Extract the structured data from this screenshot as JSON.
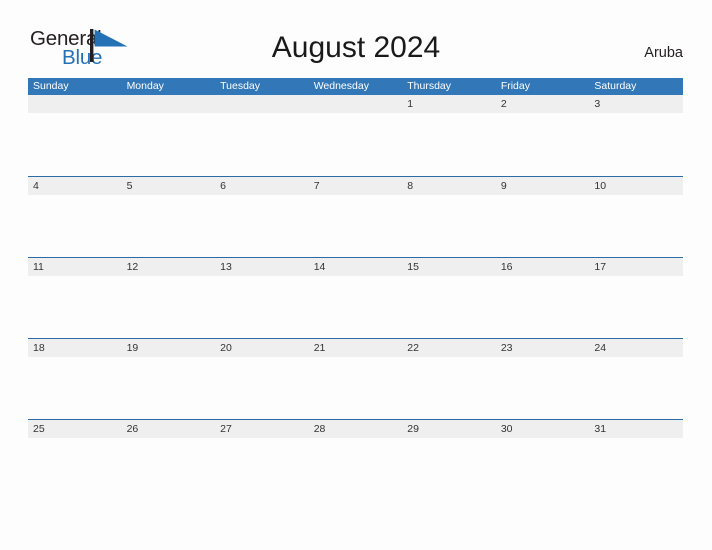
{
  "brand": {
    "word_one": "General",
    "word_two": "Blue",
    "flag_icon": "blue-flag-icon",
    "color_dark": "#231f20",
    "color_blue": "#2571b6"
  },
  "header": {
    "title": "August 2024",
    "country": "Aruba"
  },
  "calendar": {
    "month": "August",
    "year": "2024",
    "header_bg": "#3277b8",
    "row_border_color": "#2b6ca8",
    "date_band_bg": "#efefef",
    "weekdays": [
      "Sunday",
      "Monday",
      "Tuesday",
      "Wednesday",
      "Thursday",
      "Friday",
      "Saturday"
    ],
    "weeks": [
      [
        "",
        "",
        "",
        "",
        "1",
        "2",
        "3"
      ],
      [
        "4",
        "5",
        "6",
        "7",
        "8",
        "9",
        "10"
      ],
      [
        "11",
        "12",
        "13",
        "14",
        "15",
        "16",
        "17"
      ],
      [
        "18",
        "19",
        "20",
        "21",
        "22",
        "23",
        "24"
      ],
      [
        "25",
        "26",
        "27",
        "28",
        "29",
        "30",
        "31"
      ]
    ]
  }
}
